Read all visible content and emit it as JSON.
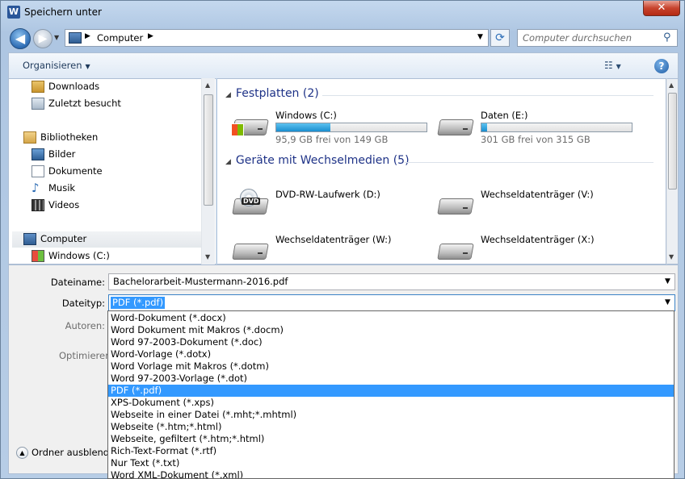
{
  "window": {
    "title": "Speichern unter",
    "app_icon": "W",
    "close_label": "✕"
  },
  "address": {
    "crumb": "Computer",
    "refresh_glyph": "⟳"
  },
  "search": {
    "placeholder": "Computer durchsuchen"
  },
  "toolbar": {
    "organize_label": "Organisieren",
    "help_label": "?"
  },
  "nav": {
    "items": [
      {
        "label": "Downloads",
        "icon": "downloads-folder-icon"
      },
      {
        "label": "Zuletzt besucht",
        "icon": "recent-places-icon"
      },
      {
        "label": "Bibliotheken",
        "icon": "libraries-icon"
      },
      {
        "label": "Bilder",
        "icon": "pictures-icon"
      },
      {
        "label": "Dokumente",
        "icon": "documents-icon"
      },
      {
        "label": "Musik",
        "icon": "music-icon"
      },
      {
        "label": "Videos",
        "icon": "videos-icon"
      },
      {
        "label": "Computer",
        "icon": "computer-icon",
        "selected": true
      },
      {
        "label": "Windows (C:)",
        "icon": "windows-drive-icon"
      }
    ]
  },
  "content": {
    "groups": [
      {
        "title": "Festplatten (2)"
      },
      {
        "title": "Geräte mit Wechselmedien (5)"
      }
    ],
    "hard_disks": [
      {
        "name": "Windows (C:)",
        "info": "95,9 GB frei von 149 GB",
        "used_fraction": 0.36
      },
      {
        "name": "Daten (E:)",
        "info": "301 GB frei von 315 GB",
        "used_fraction": 0.04
      }
    ],
    "removable": [
      {
        "name": "DVD-RW-Laufwerk (D:)",
        "disc_tag": "DVD"
      },
      {
        "name": "Wechseldatenträger (V:)"
      },
      {
        "name": "Wechseldatenträger (W:)"
      },
      {
        "name": "Wechseldatenträger (X:)"
      }
    ]
  },
  "form": {
    "filename_label": "Dateiname:",
    "filename_value": "Bachelorarbeit-Mustermann-2016.pdf",
    "filetype_label": "Dateityp:",
    "filetype_value": "PDF (*.pdf)",
    "authors_label": "Autoren:",
    "optimize_label": "Optimieren",
    "hide_folders_label": "Ordner ausblende"
  },
  "filetype_options": [
    "Word-Dokument (*.docx)",
    "Word Dokument mit Makros (*.docm)",
    "Word 97-2003-Dokument (*.doc)",
    "Word-Vorlage (*.dotx)",
    "Word Vorlage mit Makros (*.dotm)",
    "Word 97-2003-Vorlage (*.dot)",
    "PDF (*.pdf)",
    "XPS-Dokument (*.xps)",
    "Webseite in einer Datei (*.mht;*.mhtml)",
    "Webseite (*.htm;*.html)",
    "Webseite, gefiltert (*.htm;*.html)",
    "Rich-Text-Format (*.rtf)",
    "Nur Text (*.txt)",
    "Word XML-Dokument (*.xml)"
  ],
  "selected_option": "PDF (*.pdf)",
  "colors": {
    "selection": "#3399ff",
    "group_header": "#1e3287",
    "drive_fill": "#1a8ecf"
  }
}
